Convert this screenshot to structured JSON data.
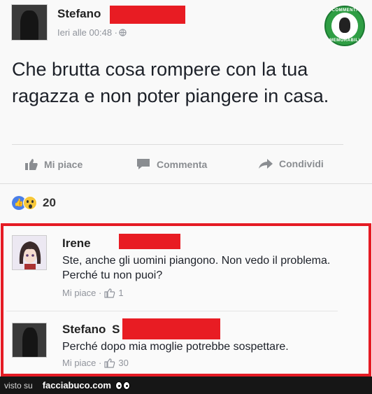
{
  "post": {
    "author": "Stefano",
    "timestamp": "Ieri alle 00:48 · ",
    "privacy_icon": "globe-icon",
    "text": "Che brutta cosa rompere con la tua ragazza e non poter piangere in casa.",
    "actions": {
      "like": "Mi piace",
      "comment": "Commenta",
      "share": "Condividi"
    },
    "reaction_count": "20"
  },
  "watermark": {
    "top": "COMMENTI",
    "bottom": "MEMORABILI"
  },
  "comments": [
    {
      "author": "Irene",
      "text": "Ste, anche gli uomini piangono. Non vedo il problema. Perché tu non puoi?",
      "like_label": "Mi piace ·",
      "like_count": "1"
    },
    {
      "author": "Stefano",
      "author_suffix": "S",
      "text": "Perché dopo mia moglie potrebbe sospettare.",
      "like_label": "Mi piace ·",
      "like_count": "30"
    }
  ],
  "footer": {
    "prefix": "visto su",
    "site": "facciabuco.com"
  },
  "colors": {
    "redaction": "#e81c23",
    "highlight_border": "#e51b24",
    "facebook_blue": "#4a7fe8",
    "footer_bg": "#161616"
  }
}
